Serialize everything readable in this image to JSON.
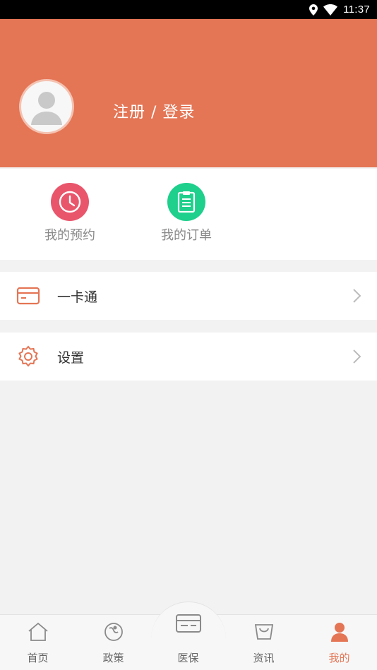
{
  "status_bar": {
    "time": "11:37",
    "icons": [
      "location-icon",
      "wifi-icon"
    ]
  },
  "profile": {
    "login_label": "注册 / 登录",
    "avatar": "default-avatar-icon"
  },
  "shortcuts": [
    {
      "label": "我的预约",
      "icon": "clock-icon",
      "color": "#e9556b"
    },
    {
      "label": "我的订单",
      "icon": "clipboard-icon",
      "color": "#1fcf8c"
    }
  ],
  "menu": [
    {
      "label": "一卡通",
      "icon": "card-icon"
    },
    {
      "label": "设置",
      "icon": "gear-icon"
    }
  ],
  "tabs": [
    {
      "label": "首页",
      "icon": "home-icon"
    },
    {
      "label": "政策",
      "icon": "policy-icon"
    },
    {
      "label": "医保",
      "icon": "insurance-card-icon"
    },
    {
      "label": "资讯",
      "icon": "news-bag-icon"
    },
    {
      "label": "我的",
      "icon": "user-icon",
      "active": true
    }
  ],
  "colors": {
    "brand": "#e47555",
    "tab_inactive": "#8a8a8a",
    "divider": "#f2f2f2"
  }
}
